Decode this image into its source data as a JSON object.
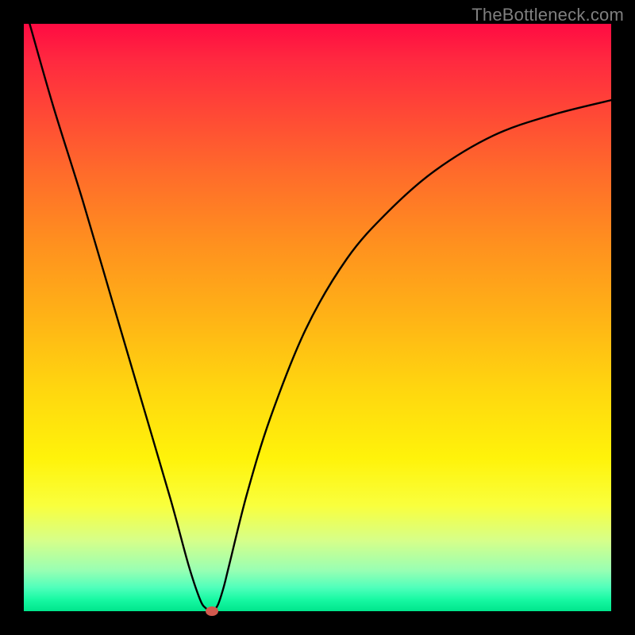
{
  "watermark": {
    "text": "TheBottleneck.com"
  },
  "chart_data": {
    "type": "line",
    "title": "",
    "xlabel": "",
    "ylabel": "",
    "xlim": [
      0,
      100
    ],
    "ylim": [
      0,
      100
    ],
    "grid": false,
    "series": [
      {
        "name": "curve",
        "x": [
          1,
          5,
          10,
          15,
          20,
          25,
          28,
          30,
          31,
          32,
          33,
          34,
          35,
          38,
          42,
          48,
          55,
          62,
          70,
          80,
          90,
          100
        ],
        "y": [
          100,
          86,
          70,
          53,
          36,
          19,
          8,
          2,
          0.5,
          0,
          1,
          4,
          8,
          20,
          33,
          48,
          60,
          68,
          75,
          81,
          84.5,
          87
        ]
      }
    ],
    "marker_point": {
      "x": 32,
      "y": 0,
      "color": "#d15a4e"
    },
    "gradient_colors": {
      "top": "#ff0b42",
      "mid1": "#ff8f1f",
      "mid2": "#ffd60f",
      "mid3": "#fff30a",
      "bottom": "#00e58c"
    }
  }
}
